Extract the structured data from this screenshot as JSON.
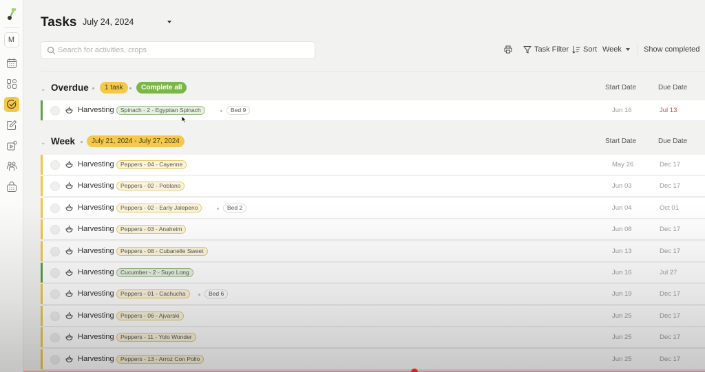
{
  "sidebar": {
    "workspace_initial": "M",
    "items": [
      {
        "icon": "calendar-icon",
        "active": false
      },
      {
        "icon": "dashboard-icon",
        "active": false
      },
      {
        "icon": "tasks-check-icon",
        "active": true
      },
      {
        "icon": "edit-icon",
        "active": false
      },
      {
        "icon": "video-icon",
        "active": false
      },
      {
        "icon": "team-icon",
        "active": false
      },
      {
        "icon": "basket-icon",
        "active": false
      }
    ],
    "active_color": "#f3c84b"
  },
  "header": {
    "title": "Tasks",
    "date_selected": "July 24, 2024",
    "search_placeholder": "Search for activities, crops",
    "search_value": ""
  },
  "toolbar": {
    "print_icon": "printer-icon",
    "task_filter": "Task Filter",
    "sort": "Sort",
    "range": "Week",
    "show_completed": "Show completed"
  },
  "sections": {
    "overdue": {
      "title": "Overdue",
      "count_badge": "1 task",
      "complete_all": "Complete all",
      "start_col": "Start Date",
      "due_col": "Due Date",
      "rows": [
        {
          "activity": "Harvesting",
          "crop": "Spinach - 2 - Egyptian Spinach",
          "bed": "Bed 9",
          "start": "Jun 16",
          "due": "Jul 13",
          "color": "green",
          "late": true
        }
      ]
    },
    "week": {
      "title": "Week",
      "range_badge": "July 21, 2024 - July 27, 2024",
      "start_col": "Start Date",
      "due_col": "Due Date",
      "rows": [
        {
          "activity": "Harvesting",
          "crop": "Peppers - 04 - Cayenne",
          "bed": "",
          "start": "May 26",
          "due": "Dec 17",
          "color": "yellow"
        },
        {
          "activity": "Harvesting",
          "crop": "Peppers - 02 - Poblano",
          "bed": "",
          "start": "Jun 03",
          "due": "Dec 17",
          "color": "yellow"
        },
        {
          "activity": "Harvesting",
          "crop": "Peppers - 02 - Early Jalepeno",
          "bed": "Bed 2",
          "start": "Jun 04",
          "due": "Oct 01",
          "color": "yellow"
        },
        {
          "activity": "Harvesting",
          "crop": "Peppers - 03 - Anaheim",
          "bed": "",
          "start": "Jun 08",
          "due": "Dec 17",
          "color": "yellow"
        },
        {
          "activity": "Harvesting",
          "crop": "Peppers - 08 - Cubanelle Sweet",
          "bed": "",
          "start": "Jun 13",
          "due": "Dec 17",
          "color": "yellow"
        },
        {
          "activity": "Harvesting",
          "crop": "Cucumber - 2 - Suyo Long",
          "bed": "",
          "start": "Jun 16",
          "due": "Jul 27",
          "color": "green"
        },
        {
          "activity": "Harvesting",
          "crop": "Peppers - 01 - Cachucha",
          "bed": "Bed 6",
          "start": "Jun 19",
          "due": "Dec 17",
          "color": "yellow"
        },
        {
          "activity": "Harvesting",
          "crop": "Peppers - 06 - Ajvarski",
          "bed": "",
          "start": "Jun 25",
          "due": "Dec 17",
          "color": "yellow"
        },
        {
          "activity": "Harvesting",
          "crop": "Peppers - 11 - Yolo Wonder",
          "bed": "",
          "start": "Jun 25",
          "due": "Dec 17",
          "color": "yellow"
        },
        {
          "activity": "Harvesting",
          "crop": "Peppers - 13 - Arroz Con Pollo",
          "bed": "",
          "start": "Jun 25",
          "due": "Dec 17",
          "color": "yellow"
        }
      ]
    }
  },
  "colors": {
    "yellow": "#f0c63e",
    "green": "#5f9e45",
    "late": "#c9434f",
    "complete_all": "#7ab648"
  }
}
